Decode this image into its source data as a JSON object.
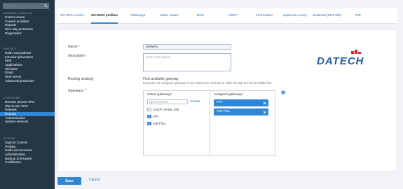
{
  "sidebar": {
    "search_placeholder": "Search",
    "sections": [
      {
        "header": "MONITOR & ANALYZE",
        "items": [
          "Control center",
          "Current activities",
          "Reports",
          "Zero-day protection",
          "Diagnostics"
        ]
      },
      {
        "header": "PROTECT",
        "items": [
          "Rules and policies",
          "Intrusion prevention",
          "Web",
          "Applications",
          "Wireless",
          "Email",
          "Web server",
          "Advanced protection"
        ]
      },
      {
        "header": "CONFIGURE",
        "items": [
          "Remote access VPN",
          "Site-to-site VPN",
          "Network",
          "Routing",
          "Authentication",
          "System services"
        ]
      },
      {
        "header": "SYSTEM",
        "items": [
          "Sophos Central",
          "Profiles",
          "Hosts and services",
          "Administration",
          "Backup & firmware",
          "Certificates"
        ]
      }
    ],
    "active_item": "Routing"
  },
  "tabs": [
    "SD-WAN routes",
    "SD-WAN profiles",
    "Gateways",
    "Static routes",
    "BGP",
    "OSPF",
    "Information",
    "Upstream proxy",
    "Multicast (PIM-SM)",
    "RIP"
  ],
  "active_tab": "SD-WAN profiles",
  "form": {
    "name_label": "Name *",
    "name_value": "SDWAN",
    "description_label": "Description",
    "description_placeholder": "Enter Description",
    "routing_strategy_label": "Routing strategy",
    "routing_strategy_value": "First available gateway",
    "routing_strategy_help": "Evaluates the assigned gateways in the listed order and steers traffic through the first available link.",
    "gateways_label": "Gateways *"
  },
  "gateways": {
    "select_title": "Select gateways",
    "search_placeholder": "type to search...",
    "create_label": "Create",
    "options": [
      {
        "label": "DHCP_Port8_GW",
        "checked": false
      },
      {
        "label": "FPT",
        "checked": true
      },
      {
        "label": "VIETTEL",
        "checked": true
      }
    ],
    "assigned_title": "Assigned gateways",
    "assigned": [
      "FPT",
      "VIETTEL"
    ]
  },
  "logo": {
    "text": "DATECH",
    "color": "#1f5fa8",
    "accent": "#d9272e"
  },
  "footer": {
    "save_label": "Save",
    "cancel_label": "Cancel"
  },
  "colors": {
    "sidebar_bg": "#243746",
    "accent": "#2f86d6",
    "link": "#2a6fb0"
  }
}
